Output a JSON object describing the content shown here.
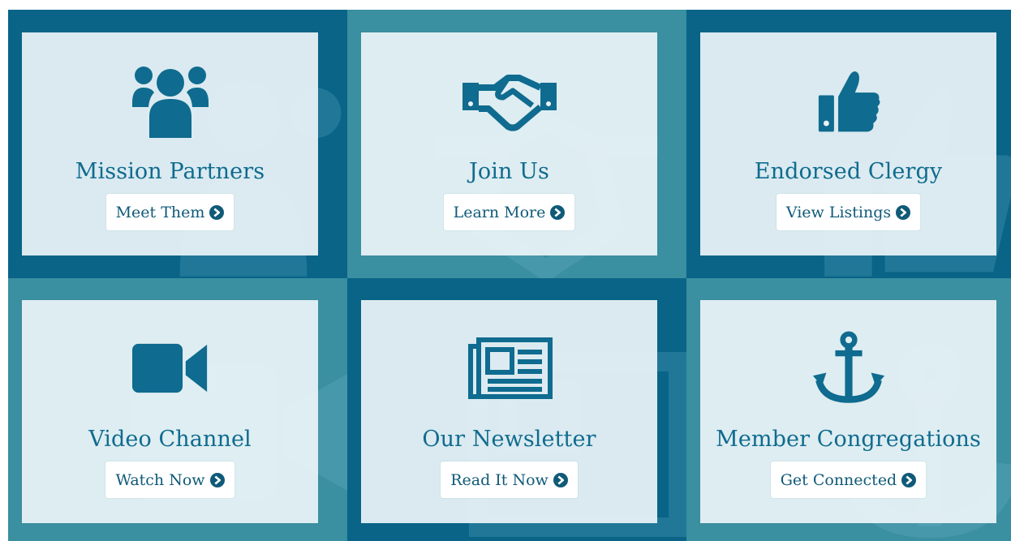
{
  "colors": {
    "dark_tile": "#0b6a8f",
    "light_tile": "#3a8fa0",
    "card": "#ebf4f7",
    "accent": "#0f6b8f"
  },
  "tiles": [
    {
      "title": "Mission Partners",
      "button": "Meet Them",
      "icon": "users-icon"
    },
    {
      "title": "Join Us",
      "button": "Learn More",
      "icon": "handshake-icon"
    },
    {
      "title": "Endorsed Clergy",
      "button": "View Listings",
      "icon": "thumbs-up-icon"
    },
    {
      "title": "Video Channel",
      "button": "Watch Now",
      "icon": "video-camera-icon"
    },
    {
      "title": "Our Newsletter",
      "button": "Read It Now",
      "icon": "newspaper-icon"
    },
    {
      "title": "Member Congregations",
      "button": "Get Connected",
      "icon": "anchor-icon"
    }
  ]
}
